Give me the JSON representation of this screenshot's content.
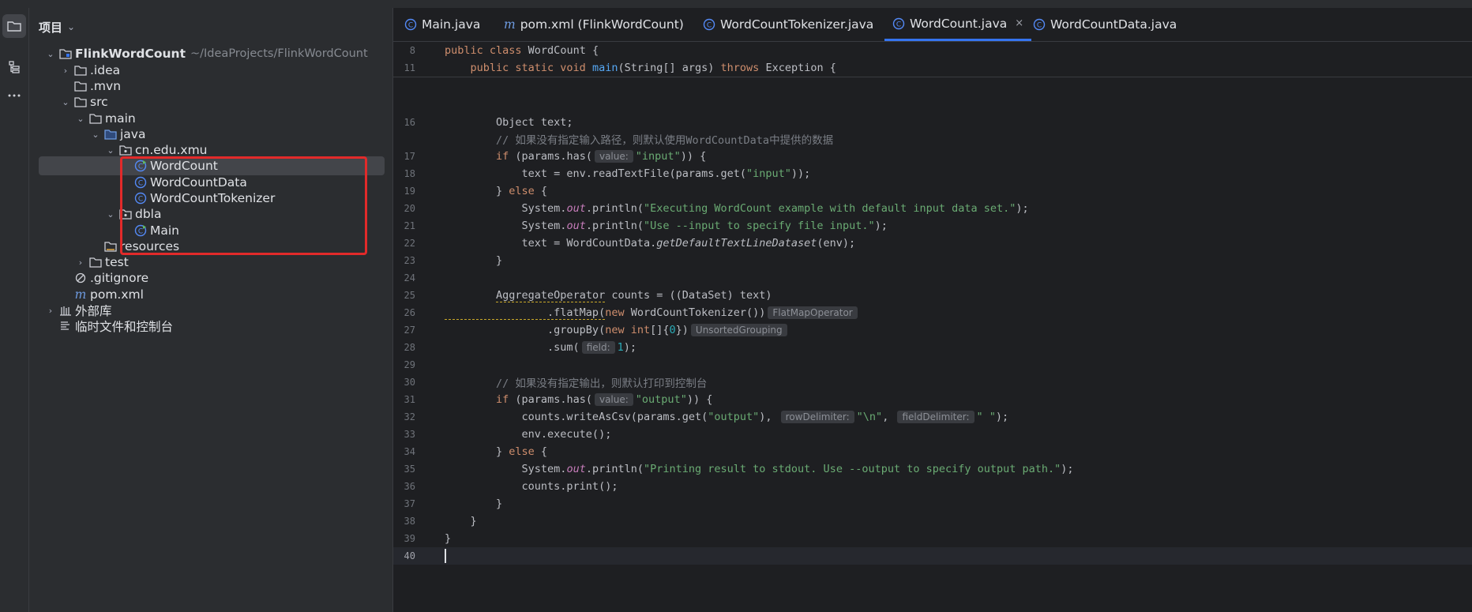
{
  "project_panel": {
    "title": "项目",
    "tree": [
      {
        "label": "FlinkWordCount",
        "path": "~/IdeaProjects/FlinkWordCount"
      },
      {
        "label": ".idea"
      },
      {
        "label": ".mvn"
      },
      {
        "label": "src"
      },
      {
        "label": "main"
      },
      {
        "label": "java"
      },
      {
        "label": "cn.edu.xmu"
      },
      {
        "label": "WordCount"
      },
      {
        "label": "WordCountData"
      },
      {
        "label": "WordCountTokenizer"
      },
      {
        "label": "dbla"
      },
      {
        "label": "Main"
      },
      {
        "label": "resources"
      },
      {
        "label": "test"
      },
      {
        "label": ".gitignore"
      },
      {
        "label": "pom.xml"
      },
      {
        "label": "外部库"
      },
      {
        "label": "临时文件和控制台"
      }
    ]
  },
  "tabs": [
    {
      "label": "Main.java"
    },
    {
      "label": "pom.xml (FlinkWordCount)"
    },
    {
      "label": "WordCountTokenizer.java"
    },
    {
      "label": "WordCount.java",
      "active": true
    },
    {
      "label": "WordCountData.java"
    }
  ],
  "editor": {
    "line_numbers": [
      "8",
      "11",
      "16",
      "17",
      "18",
      "19",
      "20",
      "21",
      "22",
      "23",
      "24",
      "25",
      "26",
      "27",
      "28",
      "29",
      "30",
      "31",
      "32",
      "33",
      "34",
      "35",
      "36",
      "37",
      "38",
      "39",
      "40"
    ],
    "hints": {
      "value1": "value:",
      "flatmap_type": "FlatMapOperator",
      "groupby_type": "UnsortedGrouping",
      "field": "field:",
      "value2": "value:",
      "row_delimiter": "rowDelimiter:",
      "field_delimiter": "fieldDelimiter:"
    },
    "lines": {
      "l8": "public class WordCount {",
      "l11": "    public static void main(String[] args) throws Exception {",
      "l16": "        Object text;",
      "l16b": "        // 如果没有指定输入路径，则默认使用WordCountData中提供的数据",
      "l20": "\"Executing WordCount example with default input data set.\"",
      "l21": "\"Use --input to specify file input.\"",
      "l30": "        // 如果没有指定输出，则默认打印到控制台",
      "l35": "\"Printing result to stdout. Use --output to specify output path.\""
    }
  },
  "colors": {
    "accent": "#3574f0",
    "highlight_box": "#e22a2a"
  }
}
